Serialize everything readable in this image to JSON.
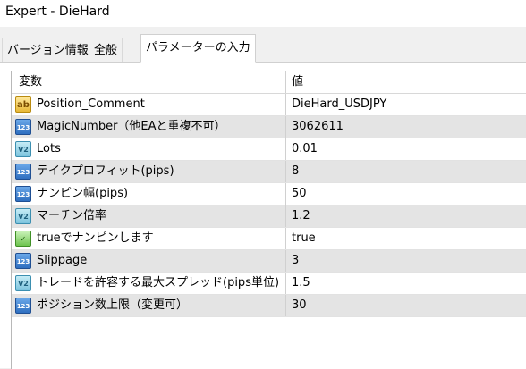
{
  "window": {
    "title": "Expert - DieHard"
  },
  "tabs": [
    {
      "label": "バージョン情報",
      "active": false
    },
    {
      "label": "全般",
      "active": false
    },
    {
      "label": "パラメーターの入力",
      "active": true
    }
  ],
  "table": {
    "columns": {
      "variable": "変数",
      "value": "値"
    },
    "rows": [
      {
        "type_icon": "string-type-icon",
        "icon_text": "ab",
        "name": "Position_Comment",
        "value": "DieHard_USDJPY"
      },
      {
        "type_icon": "integer-type-icon",
        "icon_text": "123",
        "name": "MagicNumber（他EAと重複不可）",
        "value": "3062611"
      },
      {
        "type_icon": "double-type-icon",
        "icon_text": "V2",
        "name": "Lots",
        "value": "0.01"
      },
      {
        "type_icon": "integer-type-icon",
        "icon_text": "123",
        "name": "テイクプロフィット(pips)",
        "value": "8"
      },
      {
        "type_icon": "integer-type-icon",
        "icon_text": "123",
        "name": "ナンピン幅(pips)",
        "value": "50"
      },
      {
        "type_icon": "double-type-icon",
        "icon_text": "V2",
        "name": "マーチン倍率",
        "value": "1.2"
      },
      {
        "type_icon": "bool-type-icon",
        "icon_text": "✓",
        "name": "trueでナンピンします",
        "value": "true"
      },
      {
        "type_icon": "integer-type-icon",
        "icon_text": "123",
        "name": "Slippage",
        "value": "3"
      },
      {
        "type_icon": "double-type-icon",
        "icon_text": "V2",
        "name": "トレードを許容する最大スプレッド(pips単位)",
        "value": "1.5"
      },
      {
        "type_icon": "integer-type-icon",
        "icon_text": "123",
        "name": "ポジション数上限（変更可）",
        "value": "30"
      }
    ]
  }
}
